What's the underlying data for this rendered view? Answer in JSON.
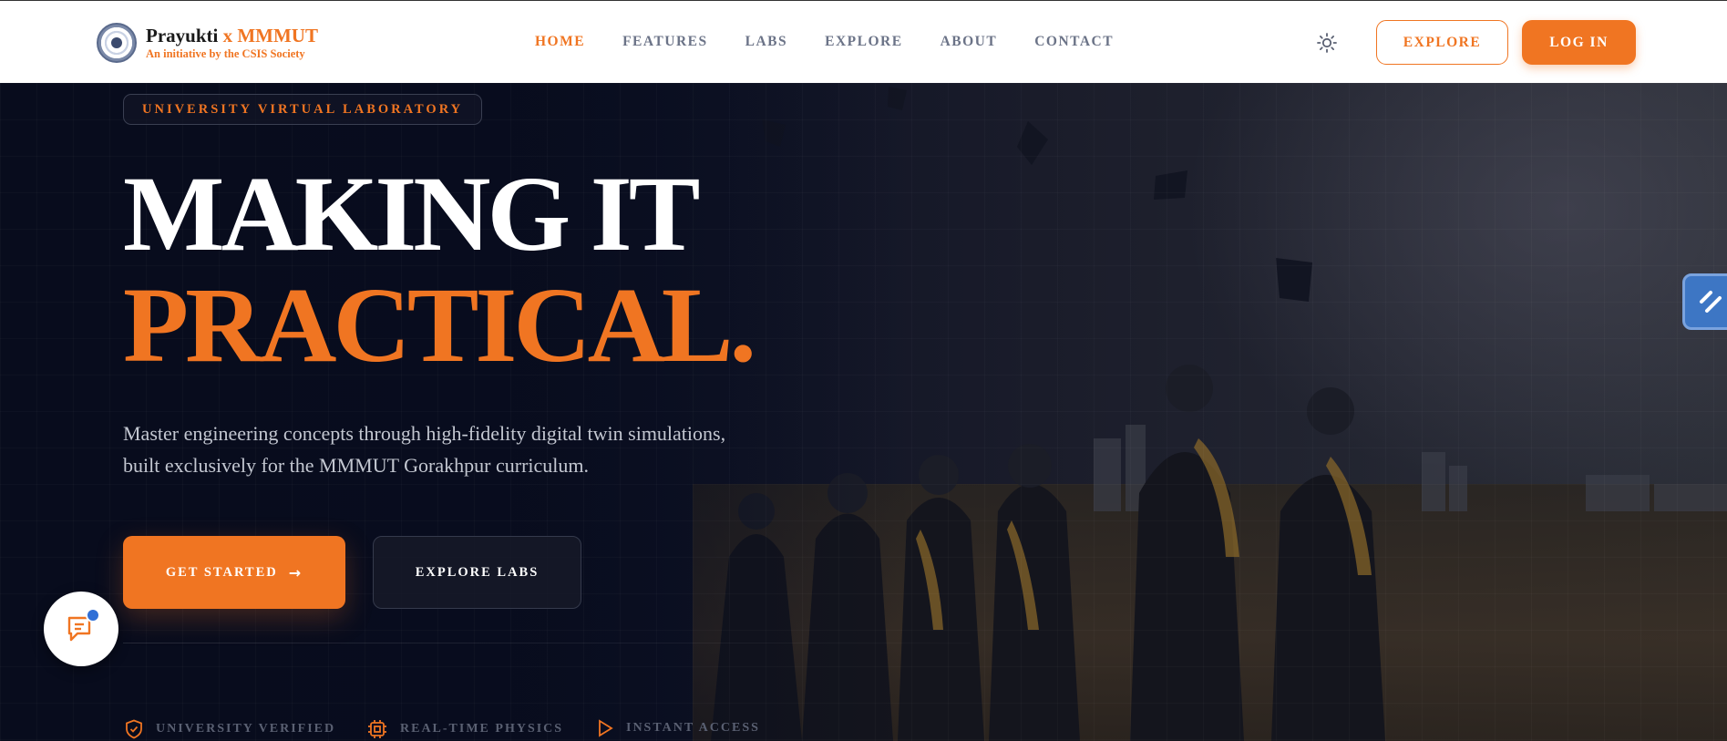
{
  "brand": {
    "title_main": "Prayukti",
    "title_accent": "x MMMUT",
    "subtitle": "An initiative by the CSIS Society",
    "logo_icon": "university-seal-icon"
  },
  "nav": {
    "items": [
      {
        "label": "HOME",
        "active": true
      },
      {
        "label": "FEATURES",
        "active": false
      },
      {
        "label": "LABS",
        "active": false
      },
      {
        "label": "EXPLORE",
        "active": false
      },
      {
        "label": "ABOUT",
        "active": false
      },
      {
        "label": "CONTACT",
        "active": false
      }
    ],
    "theme_icon": "sun-icon",
    "explore_label": "EXPLORE",
    "login_label": "LOG IN"
  },
  "hero": {
    "badge": "UNIVERSITY VIRTUAL LABORATORY",
    "headline_line1": "MAKING IT",
    "headline_line2": "PRACTICAL.",
    "description": "Master engineering concepts through high-fidelity digital twin simulations, built exclusively for the MMMUT Gorakhpur curriculum.",
    "primary_cta": "GET STARTED",
    "primary_cta_icon": "arrow-right-icon",
    "secondary_cta": "EXPLORE LABS"
  },
  "features": [
    {
      "label": "UNIVERSITY VERIFIED",
      "icon": "shield-check-icon"
    },
    {
      "label": "REAL-TIME PHYSICS",
      "icon": "cpu-chip-icon"
    },
    {
      "label": "INSTANT ACCESS",
      "icon": "play-icon"
    }
  ],
  "colors": {
    "accent": "#f07522",
    "hero_background": "#0b0f1f",
    "nav_text": "#6b7387",
    "chat_dot": "#2f6fd6",
    "side_tab": "#3d76c4"
  },
  "widgets": {
    "chat_icon": "chat-bubble-icon",
    "side_tab_icon": "stripe-link-icon"
  }
}
